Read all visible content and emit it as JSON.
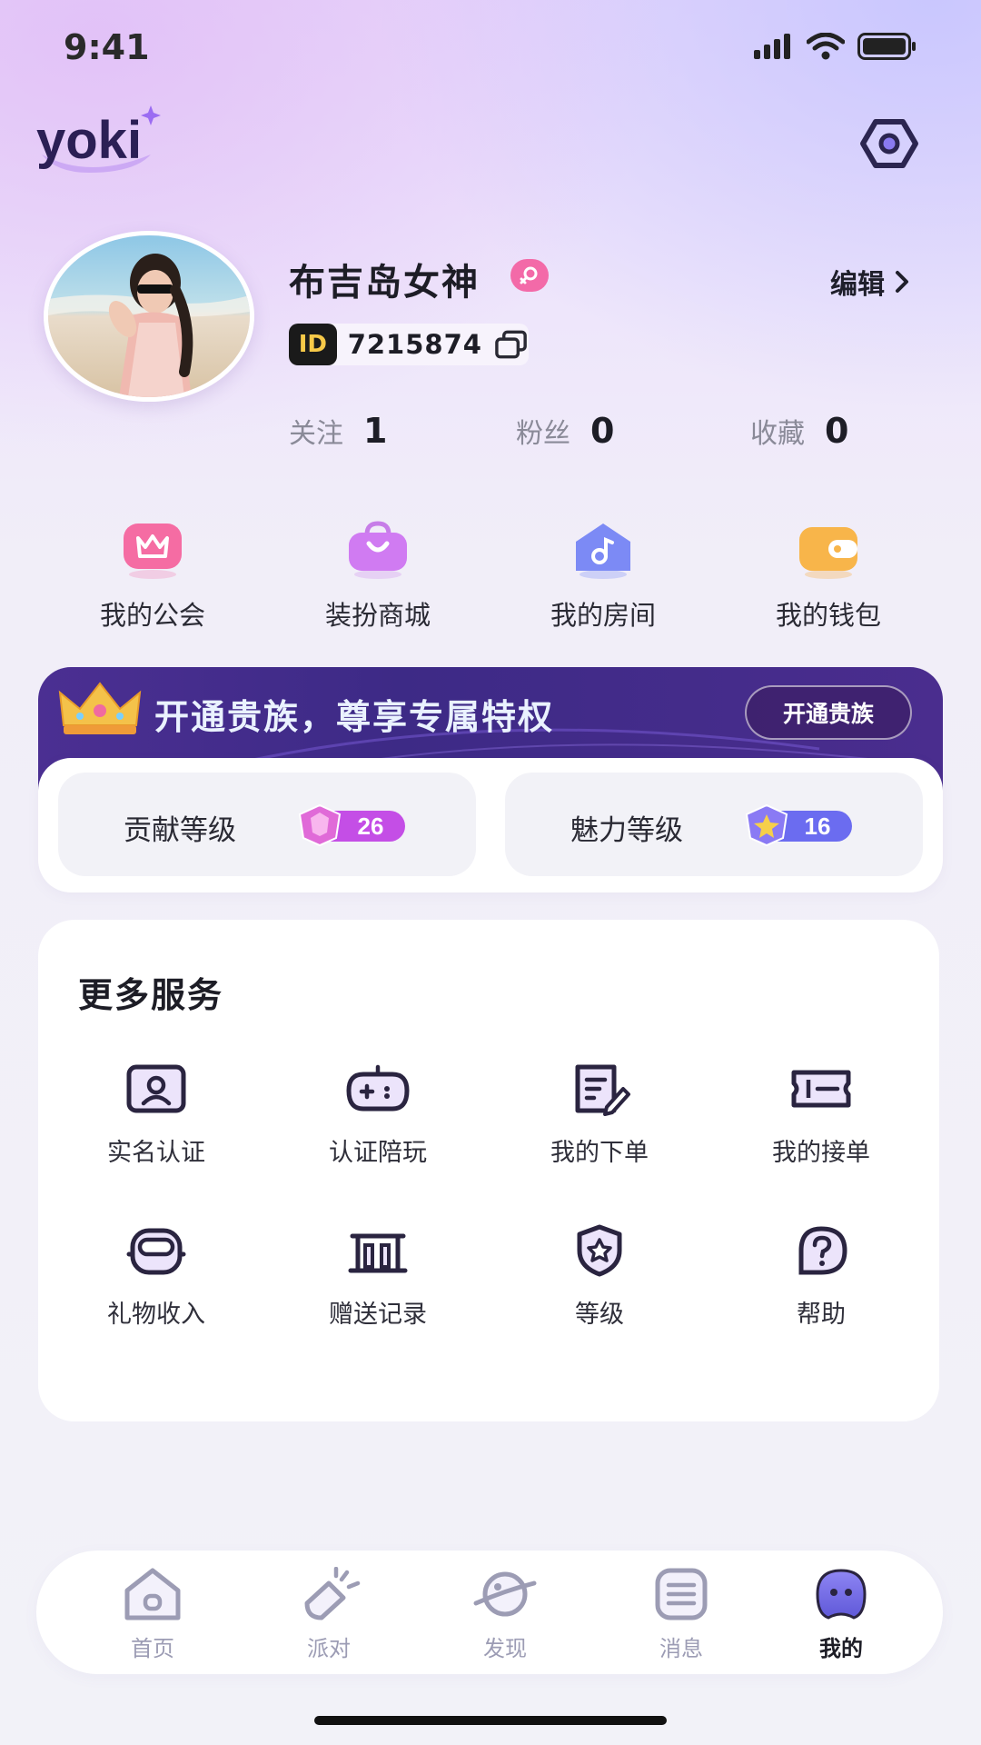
{
  "status_bar": {
    "time": "9:41"
  },
  "brand": {
    "logo_text": "yoki"
  },
  "profile": {
    "name": "布吉岛女神",
    "edit_label": "编辑",
    "id_tag": "ID",
    "id_number": "7215874",
    "stats": [
      {
        "label": "关注",
        "value": "1"
      },
      {
        "label": "粉丝",
        "value": "0"
      },
      {
        "label": "收藏",
        "value": "0"
      }
    ]
  },
  "quick_actions": [
    {
      "label": "我的公会",
      "icon": "crown-icon",
      "color": "#f36aa8"
    },
    {
      "label": "装扮商城",
      "icon": "shopping-bag-icon",
      "color": "#d27cf0"
    },
    {
      "label": "我的房间",
      "icon": "music-house-icon",
      "color": "#7b8cf4"
    },
    {
      "label": "我的钱包",
      "icon": "wallet-icon",
      "color": "#f7b24a"
    }
  ],
  "vip": {
    "title": "开通贵族，尊享专属特权",
    "button": "开通贵族"
  },
  "levels": [
    {
      "label": "贡献等级",
      "value": "26"
    },
    {
      "label": "魅力等级",
      "value": "16"
    }
  ],
  "services": {
    "title": "更多服务",
    "items": [
      {
        "label": "实名认证",
        "icon": "id-card-icon"
      },
      {
        "label": "认证陪玩",
        "icon": "gamepad-icon"
      },
      {
        "label": "我的下单",
        "icon": "order-edit-icon"
      },
      {
        "label": "我的接单",
        "icon": "ticket-icon"
      },
      {
        "label": "礼物收入",
        "icon": "gift-box-icon"
      },
      {
        "label": "赠送记录",
        "icon": "record-building-icon"
      },
      {
        "label": "等级",
        "icon": "shield-star-icon"
      },
      {
        "label": "帮助",
        "icon": "help-icon"
      }
    ]
  },
  "tabbar": {
    "items": [
      {
        "label": "首页",
        "icon": "home-icon",
        "active": false
      },
      {
        "label": "派对",
        "icon": "party-icon",
        "active": false
      },
      {
        "label": "发现",
        "icon": "planet-icon",
        "active": false
      },
      {
        "label": "消息",
        "icon": "message-icon",
        "active": false
      },
      {
        "label": "我的",
        "icon": "profile-icon",
        "active": true
      }
    ]
  },
  "colors": {
    "accent": "#6a4fd6",
    "vip_banner": "#432c8c",
    "contribution_badge": "#c14fe0",
    "charm_badge": "#6a6ff0"
  }
}
